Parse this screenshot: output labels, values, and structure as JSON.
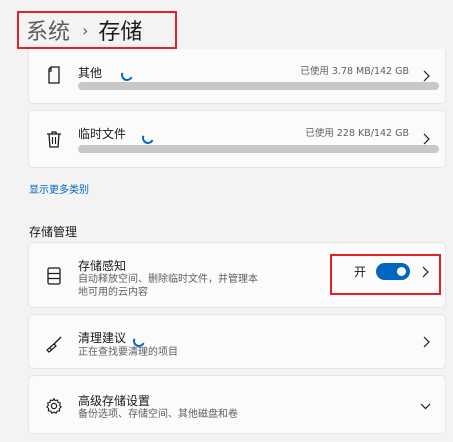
{
  "breadcrumb": {
    "parent": "系统",
    "separator": "›",
    "current": "存储"
  },
  "categories": [
    {
      "name": "其他",
      "usage_text": "已使用 3.78 MB/142 GB",
      "used_fraction": 0.0,
      "icon": "document-icon"
    },
    {
      "name": "临时文件",
      "usage_text": "已使用 228 KB/142 GB",
      "used_fraction": 0.0,
      "icon": "trash-icon"
    }
  ],
  "show_more_link": "显示更多类别",
  "management": {
    "section_title": "存储管理",
    "storage_sense": {
      "title": "存储感知",
      "description_line1": "自动释放空间、删除临时文件，并管理本",
      "description_line2": "地可用的云内容",
      "toggle_label": "开",
      "toggle_on": true,
      "icon": "storage-drive-icon"
    },
    "cleanup": {
      "title": "清理建议",
      "description": "正在查找要清理的项目",
      "icon": "broom-icon"
    },
    "advanced": {
      "title": "高级存储设置",
      "description": "备份选项、存储空间、其他磁盘和卷",
      "icon": "gear-icon"
    }
  },
  "colors": {
    "accent": "#0067c0",
    "highlight_box": "#e0212a"
  }
}
